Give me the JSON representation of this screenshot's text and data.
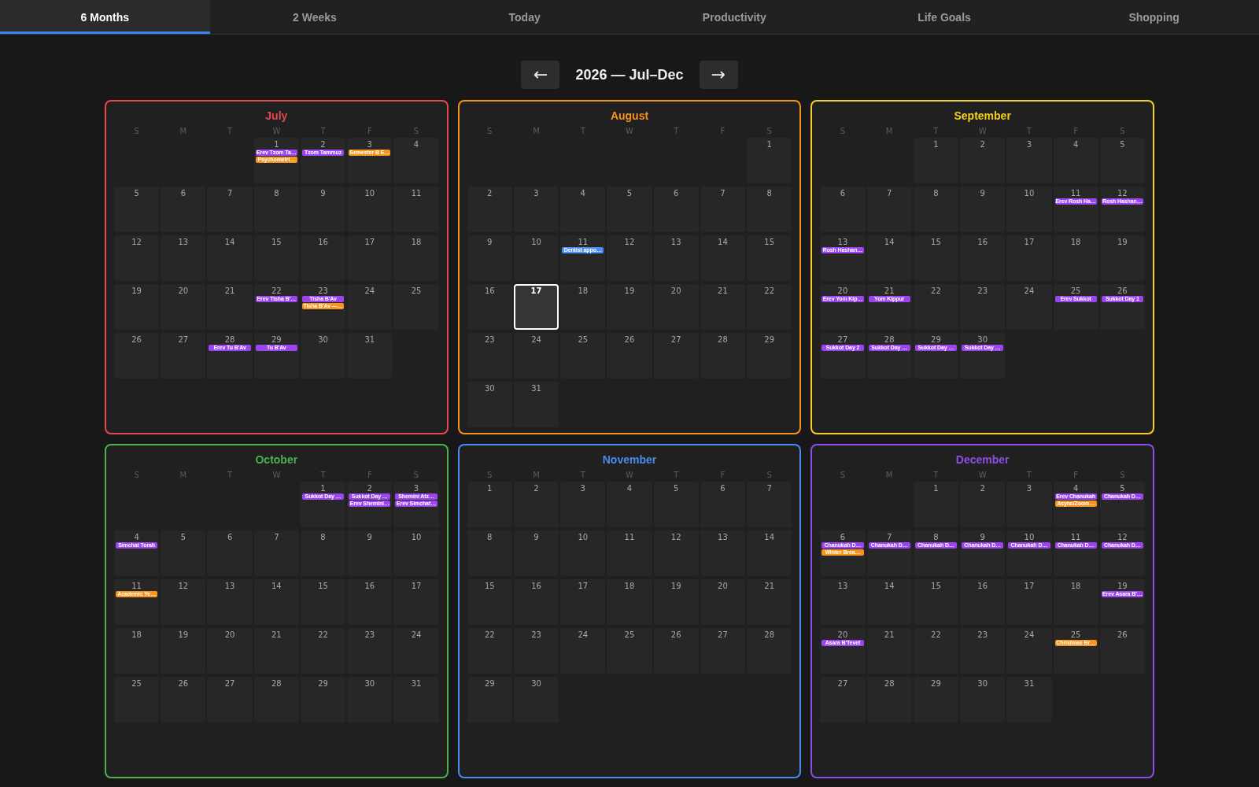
{
  "tabs": [
    {
      "label": "6 Months",
      "selected": true
    },
    {
      "label": "2 Weeks",
      "selected": false
    },
    {
      "label": "Today",
      "selected": false
    },
    {
      "label": "Productivity",
      "selected": false
    },
    {
      "label": "Life Goals",
      "selected": false
    },
    {
      "label": "Shopping",
      "selected": false
    }
  ],
  "range": {
    "prev": "←",
    "title": "2026 — Jul–Dec",
    "next": "→"
  },
  "months": [
    {
      "name": "July",
      "color": "#e5484d",
      "weekdays": [
        "S",
        "M",
        "T",
        "W",
        "T",
        "F",
        "S"
      ],
      "weeks": [
        [
          {
            "kind": "blank"
          },
          {
            "kind": "blank"
          },
          {
            "kind": "blank"
          },
          {
            "kind": "day",
            "day": "1",
            "events": [
              {
                "label": "Erev Tzom Ta…",
                "color": "#9b45f0"
              },
              {
                "label": "Psychometri…",
                "color": "#f7941d"
              }
            ]
          },
          {
            "kind": "day",
            "day": "2",
            "events": [
              {
                "label": "Tzom Tammuz",
                "color": "#9b45f0"
              }
            ]
          },
          {
            "kind": "day",
            "day": "3",
            "events": [
              {
                "label": "Semester B E…",
                "color": "#f7941d"
              }
            ]
          },
          {
            "kind": "day",
            "day": "4"
          }
        ],
        [
          {
            "kind": "day",
            "day": "5"
          },
          {
            "kind": "day",
            "day": "6"
          },
          {
            "kind": "day",
            "day": "7"
          },
          {
            "kind": "day",
            "day": "8"
          },
          {
            "kind": "day",
            "day": "9"
          },
          {
            "kind": "day",
            "day": "10"
          },
          {
            "kind": "day",
            "day": "11"
          }
        ],
        [
          {
            "kind": "day",
            "day": "12"
          },
          {
            "kind": "day",
            "day": "13"
          },
          {
            "kind": "day",
            "day": "14"
          },
          {
            "kind": "day",
            "day": "15"
          },
          {
            "kind": "day",
            "day": "16"
          },
          {
            "kind": "day",
            "day": "17"
          },
          {
            "kind": "day",
            "day": "18"
          }
        ],
        [
          {
            "kind": "day",
            "day": "19"
          },
          {
            "kind": "day",
            "day": "20"
          },
          {
            "kind": "day",
            "day": "21"
          },
          {
            "kind": "day",
            "day": "22",
            "events": [
              {
                "label": "Erev Tisha B'…",
                "color": "#9b45f0"
              }
            ]
          },
          {
            "kind": "day",
            "day": "23",
            "events": [
              {
                "label": "Tisha B'Av",
                "color": "#9b45f0"
              },
              {
                "label": "Tisha B'Av —…",
                "color": "#f7941d"
              }
            ]
          },
          {
            "kind": "day",
            "day": "24"
          },
          {
            "kind": "day",
            "day": "25"
          }
        ],
        [
          {
            "kind": "day",
            "day": "26"
          },
          {
            "kind": "day",
            "day": "27"
          },
          {
            "kind": "day",
            "day": "28",
            "events": [
              {
                "label": "Erev Tu B'Av",
                "color": "#9b45f0"
              }
            ]
          },
          {
            "kind": "day",
            "day": "29",
            "events": [
              {
                "label": "Tu B'Av",
                "color": "#9b45f0"
              }
            ]
          },
          {
            "kind": "day",
            "day": "30"
          },
          {
            "kind": "day",
            "day": "31"
          }
        ]
      ]
    },
    {
      "name": "August",
      "color": "#f5921e",
      "weekdays": [
        "S",
        "M",
        "T",
        "W",
        "T",
        "F",
        "S"
      ],
      "weeks": [
        [
          {
            "kind": "blank"
          },
          {
            "kind": "blank"
          },
          {
            "kind": "blank"
          },
          {
            "kind": "blank"
          },
          {
            "kind": "blank"
          },
          {
            "kind": "blank"
          },
          {
            "kind": "day",
            "day": "1"
          }
        ],
        [
          {
            "kind": "day",
            "day": "2"
          },
          {
            "kind": "day",
            "day": "3"
          },
          {
            "kind": "day",
            "day": "4"
          },
          {
            "kind": "day",
            "day": "5"
          },
          {
            "kind": "day",
            "day": "6"
          },
          {
            "kind": "day",
            "day": "7"
          },
          {
            "kind": "day",
            "day": "8"
          }
        ],
        [
          {
            "kind": "day",
            "day": "9"
          },
          {
            "kind": "day",
            "day": "10"
          },
          {
            "kind": "day",
            "day": "11",
            "events": [
              {
                "label": "Dentist appo…",
                "color": "#4a8ef0"
              }
            ]
          },
          {
            "kind": "day",
            "day": "12"
          },
          {
            "kind": "day",
            "day": "13"
          },
          {
            "kind": "day",
            "day": "14"
          },
          {
            "kind": "day",
            "day": "15"
          }
        ],
        [
          {
            "kind": "day",
            "day": "16"
          },
          {
            "kind": "today",
            "day": "17"
          },
          {
            "kind": "day",
            "day": "18"
          },
          {
            "kind": "day",
            "day": "19"
          },
          {
            "kind": "day",
            "day": "20"
          },
          {
            "kind": "day",
            "day": "21"
          },
          {
            "kind": "day",
            "day": "22"
          }
        ],
        [
          {
            "kind": "day",
            "day": "23"
          },
          {
            "kind": "day",
            "day": "24"
          },
          {
            "kind": "day",
            "day": "25"
          },
          {
            "kind": "day",
            "day": "26"
          },
          {
            "kind": "day",
            "day": "27"
          },
          {
            "kind": "day",
            "day": "28"
          },
          {
            "kind": "day",
            "day": "29"
          }
        ],
        [
          {
            "kind": "day",
            "day": "30"
          },
          {
            "kind": "day",
            "day": "31"
          }
        ]
      ]
    },
    {
      "name": "September",
      "color": "#f5cf23",
      "weekdays": [
        "S",
        "M",
        "T",
        "W",
        "T",
        "F",
        "S"
      ],
      "weeks": [
        [
          {
            "kind": "blank"
          },
          {
            "kind": "blank"
          },
          {
            "kind": "day",
            "day": "1"
          },
          {
            "kind": "day",
            "day": "2"
          },
          {
            "kind": "day",
            "day": "3"
          },
          {
            "kind": "day",
            "day": "4"
          },
          {
            "kind": "day",
            "day": "5"
          }
        ],
        [
          {
            "kind": "day",
            "day": "6"
          },
          {
            "kind": "day",
            "day": "7"
          },
          {
            "kind": "day",
            "day": "8"
          },
          {
            "kind": "day",
            "day": "9"
          },
          {
            "kind": "day",
            "day": "10"
          },
          {
            "kind": "day",
            "day": "11",
            "events": [
              {
                "label": "Erev Rosh Ha…",
                "color": "#9b45f0"
              }
            ]
          },
          {
            "kind": "day",
            "day": "12",
            "events": [
              {
                "label": "Rosh Hashan…",
                "color": "#9b45f0"
              }
            ]
          }
        ],
        [
          {
            "kind": "day",
            "day": "13",
            "events": [
              {
                "label": "Rosh Hashan…",
                "color": "#9b45f0"
              }
            ]
          },
          {
            "kind": "day",
            "day": "14"
          },
          {
            "kind": "day",
            "day": "15"
          },
          {
            "kind": "day",
            "day": "16"
          },
          {
            "kind": "day",
            "day": "17"
          },
          {
            "kind": "day",
            "day": "18"
          },
          {
            "kind": "day",
            "day": "19"
          }
        ],
        [
          {
            "kind": "day",
            "day": "20",
            "events": [
              {
                "label": "Erev Yom Kip…",
                "color": "#9b45f0"
              }
            ]
          },
          {
            "kind": "day",
            "day": "21",
            "events": [
              {
                "label": "Yom Kippur",
                "color": "#9b45f0"
              }
            ]
          },
          {
            "kind": "day",
            "day": "22"
          },
          {
            "kind": "day",
            "day": "23"
          },
          {
            "kind": "day",
            "day": "24"
          },
          {
            "kind": "day",
            "day": "25",
            "events": [
              {
                "label": "Erev Sukkot",
                "color": "#9b45f0"
              }
            ]
          },
          {
            "kind": "day",
            "day": "26",
            "events": [
              {
                "label": "Sukkot Day 1",
                "color": "#9b45f0"
              }
            ]
          }
        ],
        [
          {
            "kind": "day",
            "day": "27",
            "events": [
              {
                "label": "Sukkot Day 2",
                "color": "#9b45f0"
              }
            ]
          },
          {
            "kind": "day",
            "day": "28",
            "events": [
              {
                "label": "Sukkot Day …",
                "color": "#9b45f0"
              }
            ]
          },
          {
            "kind": "day",
            "day": "29",
            "events": [
              {
                "label": "Sukkot Day …",
                "color": "#9b45f0"
              }
            ]
          },
          {
            "kind": "day",
            "day": "30",
            "events": [
              {
                "label": "Sukkot Day …",
                "color": "#9b45f0"
              }
            ]
          }
        ]
      ]
    },
    {
      "name": "October",
      "color": "#4cb050",
      "weekdays": [
        "S",
        "M",
        "T",
        "W",
        "T",
        "F",
        "S"
      ],
      "weeks": [
        [
          {
            "kind": "blank"
          },
          {
            "kind": "blank"
          },
          {
            "kind": "blank"
          },
          {
            "kind": "blank"
          },
          {
            "kind": "day",
            "day": "1",
            "events": [
              {
                "label": "Sukkot Day …",
                "color": "#9b45f0"
              }
            ]
          },
          {
            "kind": "day",
            "day": "2",
            "events": [
              {
                "label": "Sukkot Day …",
                "color": "#9b45f0"
              },
              {
                "label": "Erev Shemini…",
                "color": "#9b45f0"
              }
            ]
          },
          {
            "kind": "day",
            "day": "3",
            "events": [
              {
                "label": "Shemini Atz…",
                "color": "#9b45f0"
              },
              {
                "label": "Erev Simchat…",
                "color": "#9b45f0"
              }
            ]
          }
        ],
        [
          {
            "kind": "day",
            "day": "4",
            "events": [
              {
                "label": "Simchat Torah",
                "color": "#9b45f0"
              }
            ]
          },
          {
            "kind": "day",
            "day": "5"
          },
          {
            "kind": "day",
            "day": "6"
          },
          {
            "kind": "day",
            "day": "7"
          },
          {
            "kind": "day",
            "day": "8"
          },
          {
            "kind": "day",
            "day": "9"
          },
          {
            "kind": "day",
            "day": "10"
          }
        ],
        [
          {
            "kind": "day",
            "day": "11",
            "events": [
              {
                "label": "Academic Ye…",
                "color": "#f7941d"
              }
            ]
          },
          {
            "kind": "day",
            "day": "12"
          },
          {
            "kind": "day",
            "day": "13"
          },
          {
            "kind": "day",
            "day": "14"
          },
          {
            "kind": "day",
            "day": "15"
          },
          {
            "kind": "day",
            "day": "16"
          },
          {
            "kind": "day",
            "day": "17"
          }
        ],
        [
          {
            "kind": "day",
            "day": "18"
          },
          {
            "kind": "day",
            "day": "19"
          },
          {
            "kind": "day",
            "day": "20"
          },
          {
            "kind": "day",
            "day": "21"
          },
          {
            "kind": "day",
            "day": "22"
          },
          {
            "kind": "day",
            "day": "23"
          },
          {
            "kind": "day",
            "day": "24"
          }
        ],
        [
          {
            "kind": "day",
            "day": "25"
          },
          {
            "kind": "day",
            "day": "26"
          },
          {
            "kind": "day",
            "day": "27"
          },
          {
            "kind": "day",
            "day": "28"
          },
          {
            "kind": "day",
            "day": "29"
          },
          {
            "kind": "day",
            "day": "30"
          },
          {
            "kind": "day",
            "day": "31"
          }
        ]
      ]
    },
    {
      "name": "November",
      "color": "#4a8bef",
      "weekdays": [
        "S",
        "M",
        "T",
        "W",
        "T",
        "F",
        "S"
      ],
      "weeks": [
        [
          {
            "kind": "day",
            "day": "1"
          },
          {
            "kind": "day",
            "day": "2"
          },
          {
            "kind": "day",
            "day": "3"
          },
          {
            "kind": "day",
            "day": "4"
          },
          {
            "kind": "day",
            "day": "5"
          },
          {
            "kind": "day",
            "day": "6"
          },
          {
            "kind": "day",
            "day": "7"
          }
        ],
        [
          {
            "kind": "day",
            "day": "8"
          },
          {
            "kind": "day",
            "day": "9"
          },
          {
            "kind": "day",
            "day": "10"
          },
          {
            "kind": "day",
            "day": "11"
          },
          {
            "kind": "day",
            "day": "12"
          },
          {
            "kind": "day",
            "day": "13"
          },
          {
            "kind": "day",
            "day": "14"
          }
        ],
        [
          {
            "kind": "day",
            "day": "15"
          },
          {
            "kind": "day",
            "day": "16"
          },
          {
            "kind": "day",
            "day": "17"
          },
          {
            "kind": "day",
            "day": "18"
          },
          {
            "kind": "day",
            "day": "19"
          },
          {
            "kind": "day",
            "day": "20"
          },
          {
            "kind": "day",
            "day": "21"
          }
        ],
        [
          {
            "kind": "day",
            "day": "22"
          },
          {
            "kind": "day",
            "day": "23"
          },
          {
            "kind": "day",
            "day": "24"
          },
          {
            "kind": "day",
            "day": "25"
          },
          {
            "kind": "day",
            "day": "26"
          },
          {
            "kind": "day",
            "day": "27"
          },
          {
            "kind": "day",
            "day": "28"
          }
        ],
        [
          {
            "kind": "day",
            "day": "29"
          },
          {
            "kind": "day",
            "day": "30"
          }
        ]
      ]
    },
    {
      "name": "December",
      "color": "#8f4de8",
      "weekdays": [
        "S",
        "M",
        "T",
        "W",
        "T",
        "F",
        "S"
      ],
      "weeks": [
        [
          {
            "kind": "blank"
          },
          {
            "kind": "blank"
          },
          {
            "kind": "day",
            "day": "1"
          },
          {
            "kind": "day",
            "day": "2"
          },
          {
            "kind": "day",
            "day": "3"
          },
          {
            "kind": "day",
            "day": "4",
            "events": [
              {
                "label": "Erev Chanukah",
                "color": "#9b45f0"
              },
              {
                "label": "Async/Zoom…",
                "color": "#f7941d"
              }
            ]
          },
          {
            "kind": "day",
            "day": "5",
            "events": [
              {
                "label": "Chanukah D…",
                "color": "#9b45f0"
              }
            ]
          }
        ],
        [
          {
            "kind": "day",
            "day": "6",
            "events": [
              {
                "label": "Chanukah D…",
                "color": "#9b45f0"
              },
              {
                "label": "Winter Brea…",
                "color": "#f7941d"
              }
            ]
          },
          {
            "kind": "day",
            "day": "7",
            "events": [
              {
                "label": "Chanukah D…",
                "color": "#9b45f0"
              }
            ]
          },
          {
            "kind": "day",
            "day": "8",
            "events": [
              {
                "label": "Chanukah D…",
                "color": "#9b45f0"
              }
            ]
          },
          {
            "kind": "day",
            "day": "9",
            "events": [
              {
                "label": "Chanukah D…",
                "color": "#9b45f0"
              }
            ]
          },
          {
            "kind": "day",
            "day": "10",
            "events": [
              {
                "label": "Chanukah D…",
                "color": "#9b45f0"
              }
            ]
          },
          {
            "kind": "day",
            "day": "11",
            "events": [
              {
                "label": "Chanukah D…",
                "color": "#9b45f0"
              }
            ]
          },
          {
            "kind": "day",
            "day": "12",
            "events": [
              {
                "label": "Chanukah D…",
                "color": "#9b45f0"
              }
            ]
          }
        ],
        [
          {
            "kind": "day",
            "day": "13"
          },
          {
            "kind": "day",
            "day": "14"
          },
          {
            "kind": "day",
            "day": "15"
          },
          {
            "kind": "day",
            "day": "16"
          },
          {
            "kind": "day",
            "day": "17"
          },
          {
            "kind": "day",
            "day": "18"
          },
          {
            "kind": "day",
            "day": "19",
            "events": [
              {
                "label": "Erev Asara B'…",
                "color": "#9b45f0"
              }
            ]
          }
        ],
        [
          {
            "kind": "day",
            "day": "20",
            "events": [
              {
                "label": "Asara B'Tevet",
                "color": "#9b45f0"
              }
            ]
          },
          {
            "kind": "day",
            "day": "21"
          },
          {
            "kind": "day",
            "day": "22"
          },
          {
            "kind": "day",
            "day": "23"
          },
          {
            "kind": "day",
            "day": "24"
          },
          {
            "kind": "day",
            "day": "25",
            "events": [
              {
                "label": "Christmas Br…",
                "color": "#f7941d"
              }
            ]
          },
          {
            "kind": "day",
            "day": "26"
          }
        ],
        [
          {
            "kind": "day",
            "day": "27"
          },
          {
            "kind": "day",
            "day": "28"
          },
          {
            "kind": "day",
            "day": "29"
          },
          {
            "kind": "day",
            "day": "30"
          },
          {
            "kind": "day",
            "day": "31"
          }
        ]
      ]
    }
  ]
}
